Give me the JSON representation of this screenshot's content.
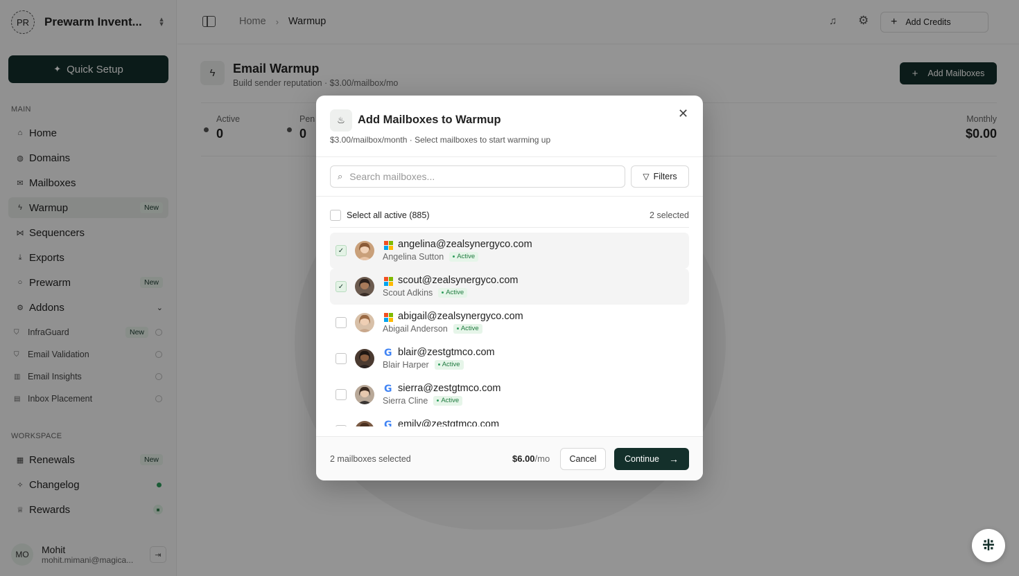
{
  "workspace": {
    "initials": "PR",
    "name": "Prewarm Invent..."
  },
  "sidebar": {
    "quick_setup": "Quick Setup",
    "main_label": "MAIN",
    "items": [
      {
        "label": "Home",
        "icon": "home-icon"
      },
      {
        "label": "Domains",
        "icon": "globe-icon"
      },
      {
        "label": "Mailboxes",
        "icon": "mail-icon"
      },
      {
        "label": "Warmup",
        "icon": "zap-icon",
        "badge": "New",
        "active": true
      },
      {
        "label": "Sequencers",
        "icon": "share-icon"
      },
      {
        "label": "Exports",
        "icon": "download-icon"
      },
      {
        "label": "Prewarm",
        "icon": "flame-icon",
        "badge": "New"
      },
      {
        "label": "Addons",
        "icon": "gear-icon"
      }
    ],
    "addons": [
      {
        "label": "InfraGuard",
        "badge": "New"
      },
      {
        "label": "Email Validation"
      },
      {
        "label": "Email Insights"
      },
      {
        "label": "Inbox Placement"
      }
    ],
    "workspace_label": "WORKSPACE",
    "workspace_items": [
      {
        "label": "Renewals",
        "badge": "New"
      },
      {
        "label": "Changelog"
      },
      {
        "label": "Rewards"
      }
    ],
    "user": {
      "initials": "MO",
      "name": "Mohit",
      "email": "mohit.mimani@magica..."
    }
  },
  "topbar": {
    "breadcrumb": [
      "Home",
      "Warmup"
    ],
    "add_credits": "Add Credits"
  },
  "page": {
    "title": "Email Warmup",
    "subtitle": "Build sender reputation · $3.00/mailbox/mo",
    "add_mailboxes": "Add Mailboxes",
    "stats": [
      {
        "label": "Active",
        "value": "0"
      },
      {
        "label": "Pen",
        "value": "0"
      },
      {
        "label": "Monthly",
        "value": "$0.00"
      }
    ]
  },
  "modal": {
    "title": "Add Mailboxes to Warmup",
    "subtitle": "$3.00/mailbox/month · Select mailboxes to start warming up",
    "search_placeholder": "Search mailboxes...",
    "filters": "Filters",
    "select_all": "Select all active (885)",
    "selected_count": "2 selected",
    "active_label": "Active",
    "mailboxes": [
      {
        "email": "angelina@zealsynergyco.com",
        "name": "Angelina Sutton",
        "provider": "microsoft",
        "checked": true
      },
      {
        "email": "scout@zealsynergyco.com",
        "name": "Scout Adkins",
        "provider": "microsoft",
        "checked": true
      },
      {
        "email": "abigail@zealsynergyco.com",
        "name": "Abigail Anderson",
        "provider": "microsoft",
        "checked": false
      },
      {
        "email": "blair@zestgtmco.com",
        "name": "Blair Harper",
        "provider": "google",
        "checked": false
      },
      {
        "email": "sierra@zestgtmco.com",
        "name": "Sierra Cline",
        "provider": "google",
        "checked": false
      },
      {
        "email": "emily@zestgtmco.com",
        "name": "",
        "provider": "google",
        "checked": false
      }
    ],
    "footer": {
      "count": "2 mailboxes selected",
      "price": "$6.00",
      "price_unit": "/mo",
      "cancel": "Cancel",
      "continue": "Continue"
    }
  },
  "colors": {
    "brand": "#14302b",
    "active_badge": "#2f9e5d"
  }
}
